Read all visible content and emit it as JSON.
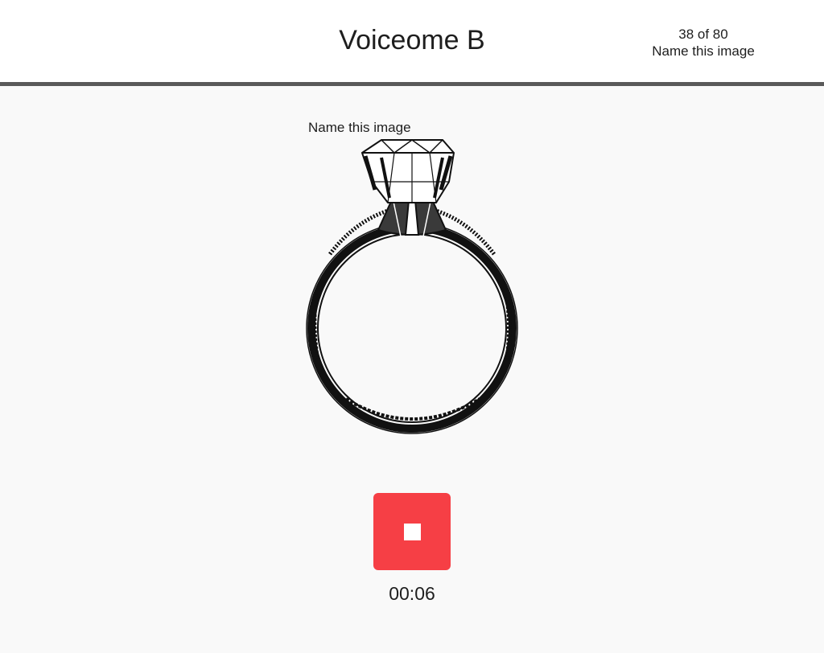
{
  "header": {
    "title": "Voiceome B",
    "progress": "38 of 80",
    "task_label": "Name this image"
  },
  "task": {
    "prompt": "Name this image",
    "image_icon": "engagement-ring-icon"
  },
  "recorder": {
    "button_icon": "stop-icon",
    "button_color": "#f63f45",
    "elapsed": "00:06"
  }
}
